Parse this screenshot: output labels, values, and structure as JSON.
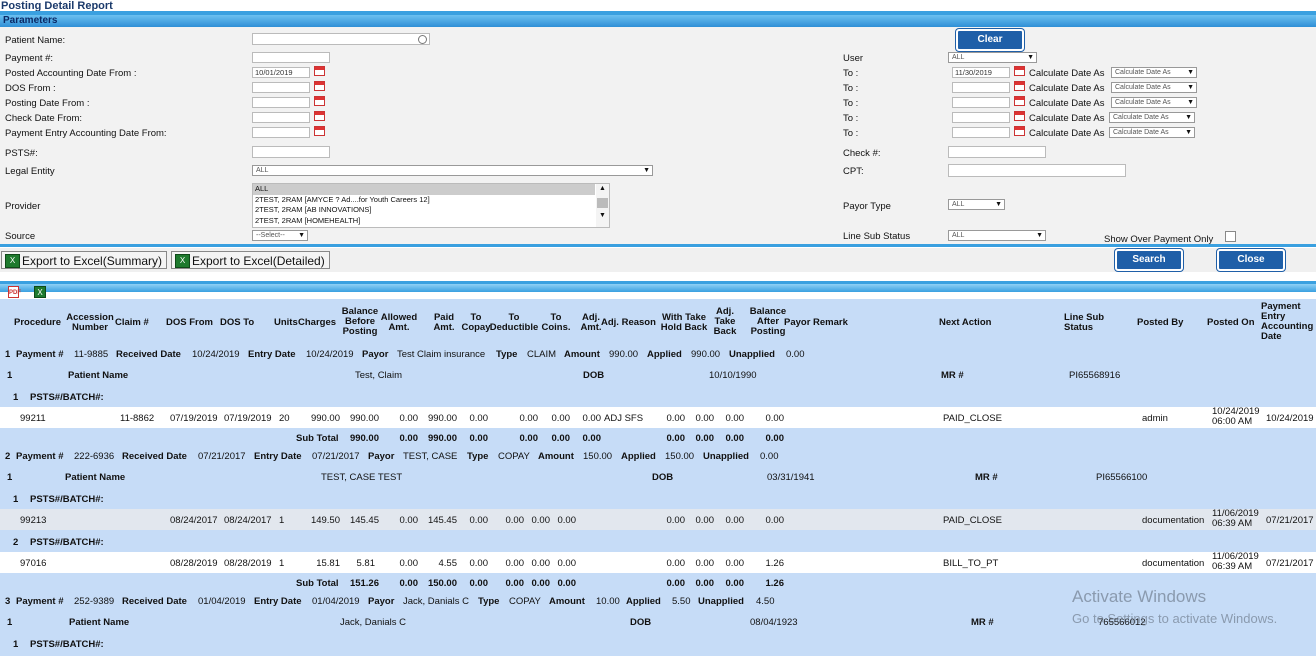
{
  "title": "Posting Detail Report",
  "params_header": "Parameters",
  "labels": {
    "patient_name": "Patient Name:",
    "payment_no": "Payment #:",
    "posted_acct_from": "Posted Accounting Date From :",
    "dos_from": "DOS From :",
    "posting_date_from": "Posting Date From :",
    "check_date_from": "Check Date From:",
    "payment_entry_from": "Payment Entry Accounting Date From:",
    "psts": "PSTS#:",
    "legal_entity": "Legal Entity",
    "provider": "Provider",
    "source": "Source",
    "user": "User",
    "to": "To :",
    "calc_date_as": "Calculate Date As",
    "check_no": "Check #:",
    "cpt": "CPT:",
    "payor_type": "Payor Type",
    "line_sub_status": "Line Sub Status",
    "show_over_payment": "Show Over Payment Only"
  },
  "values": {
    "posted_acct_from": "10/01/2019",
    "posted_acct_to": "11/30/2019",
    "user": "ALL",
    "legal_entity": "ALL",
    "source": "--Select--",
    "payor_type": "ALL",
    "line_sub_status": "ALL",
    "calc_date_as": "Calculate Date As"
  },
  "provider_options": [
    "ALL",
    "2TEST, 2RAM [AMYCE ? Ad....for Youth Careers 12]",
    "2TEST, 2RAM [AB INNOVATIONS]",
    "2TEST, 2RAM [HOMEHEALTH]"
  ],
  "buttons": {
    "clear": "Clear",
    "search": "Search",
    "close": "Close",
    "export_summary": "Export to Excel(Summary)",
    "export_detailed": "Export to Excel(Detailed)"
  },
  "columns": {
    "procedure": "Procedure",
    "accession": "Accession Number",
    "claim": "Claim #",
    "dos_from": "DOS From",
    "dos_to": "DOS To",
    "units": "Units",
    "charges": "Charges",
    "balance_before": "Balance Before Posting",
    "allowed": "Allowed Amt.",
    "paid": "Paid Amt.",
    "to_copay": "To Copay",
    "to_deductible": "To Deductible",
    "to_coins": "To Coins.",
    "adj_amt": "Adj. Amt.",
    "adj_reason": "Adj. Reason",
    "with_take": "With Take Hold Back",
    "adj_take": "Adj. Take Back",
    "balance_after": "Balance After Posting",
    "payor_remark": "Payor Remark",
    "next_action": "Next Action",
    "line_sub_status": "Line Sub Status",
    "posted_by": "Posted By",
    "posted_on": "Posted On",
    "payment_entry": "Payment Entry Accounting Date"
  },
  "kw": {
    "payment": "Payment #",
    "received": "Received Date",
    "entry": "Entry Date",
    "payor": "Payor",
    "type": "Type",
    "amount": "Amount",
    "applied": "Applied",
    "unapplied": "Unapplied",
    "patient_name": "Patient Name",
    "dob": "DOB",
    "mr": "MR #",
    "psts_batch": "PSTS#/BATCH#:",
    "sub_total": "Sub Total"
  },
  "payments": [
    {
      "idx": "1",
      "no": "11-9885",
      "received": "10/24/2019",
      "entry": "10/24/2019",
      "payor": "Test Claim insurance",
      "type": "CLAIM",
      "amount": "990.00",
      "applied": "990.00",
      "unapplied": "0.00",
      "patient_idx": "1",
      "patient": "Test, Claim",
      "dob": "10/10/1990",
      "mr": "PI65568916"
    },
    {
      "idx": "2",
      "no": "222-6936",
      "received": "07/21/2017",
      "entry": "07/21/2017",
      "payor": "TEST, CASE",
      "type": "COPAY",
      "amount": "150.00",
      "applied": "150.00",
      "unapplied": "0.00",
      "patient_idx": "1",
      "patient": "TEST, CASE TEST",
      "dob": "03/31/1941",
      "mr": "PI65566100"
    },
    {
      "idx": "3",
      "no": "252-9389",
      "received": "01/04/2019",
      "entry": "01/04/2019",
      "payor": "Jack, Danials C",
      "type": "COPAY",
      "amount": "10.00",
      "applied": "5.50",
      "unapplied": "4.50",
      "patient_idx": "1",
      "patient": "Jack, Danials C",
      "dob": "08/04/1923",
      "mr": "765566012"
    }
  ],
  "lines": [
    {
      "batch_idx": "1",
      "procedure": "99211",
      "claim": "11-8862",
      "dos_from": "07/19/2019",
      "dos_to": "07/19/2019",
      "units": "20",
      "charges": "990.00",
      "balance_before": "990.00",
      "allowed": "0.00",
      "paid": "990.00",
      "copay": "0.00",
      "deductible": "0.00",
      "coins": "0.00",
      "adj_amt": "0.00",
      "adj_reason": "ADJ SFS",
      "with_take": "0.00",
      "adj_take": "0.00",
      "take_back": "0.00",
      "balance_after": "0.00",
      "next_action": "PAID_CLOSE",
      "posted_by": "admin",
      "posted_on": "10/24/2019 06:00 AM",
      "entry_date": "10/24/2019"
    },
    {
      "batch_idx": "1",
      "procedure": "99213",
      "claim": "",
      "dos_from": "08/24/2017",
      "dos_to": "08/24/2017",
      "units": "1",
      "charges": "149.50",
      "balance_before": "145.45",
      "allowed": "0.00",
      "paid": "145.45",
      "copay": "0.00",
      "deductible": "0.00",
      "coins": "0.00",
      "adj_amt": "0.00",
      "adj_reason": "",
      "with_take": "0.00",
      "adj_take": "0.00",
      "take_back": "0.00",
      "balance_after": "0.00",
      "next_action": "PAID_CLOSE",
      "posted_by": "documentation",
      "posted_on": "11/06/2019 06:39 AM",
      "entry_date": "07/21/2017"
    },
    {
      "batch_idx": "2",
      "procedure": "97016",
      "claim": "",
      "dos_from": "08/28/2019",
      "dos_to": "08/28/2019",
      "units": "1",
      "charges": "15.81",
      "balance_before": "5.81",
      "allowed": "0.00",
      "paid": "4.55",
      "copay": "0.00",
      "deductible": "0.00",
      "coins": "0.00",
      "adj_amt": "0.00",
      "adj_reason": "",
      "with_take": "0.00",
      "adj_take": "0.00",
      "take_back": "0.00",
      "balance_after": "1.26",
      "next_action": "BILL_TO_PT",
      "posted_by": "documentation",
      "posted_on": "11/06/2019 06:39 AM",
      "entry_date": "07/21/2017"
    }
  ],
  "subtotals": [
    {
      "balance_before": "990.00",
      "allowed": "0.00",
      "paid": "990.00",
      "copay": "0.00",
      "deductible": "0.00",
      "coins": "0.00",
      "adj_amt": "0.00",
      "with_take": "0.00",
      "adj_take": "0.00",
      "take_back": "0.00",
      "balance_after": "0.00"
    },
    {
      "balance_before": "151.26",
      "allowed": "0.00",
      "paid": "150.00",
      "copay": "0.00",
      "deductible": "0.00",
      "coins": "0.00",
      "adj_amt": "0.00",
      "with_take": "0.00",
      "adj_take": "0.00",
      "take_back": "0.00",
      "balance_after": "1.26"
    }
  ],
  "watermark": {
    "line1": "Activate Windows",
    "line2": "Go to Settings to activate Windows."
  }
}
